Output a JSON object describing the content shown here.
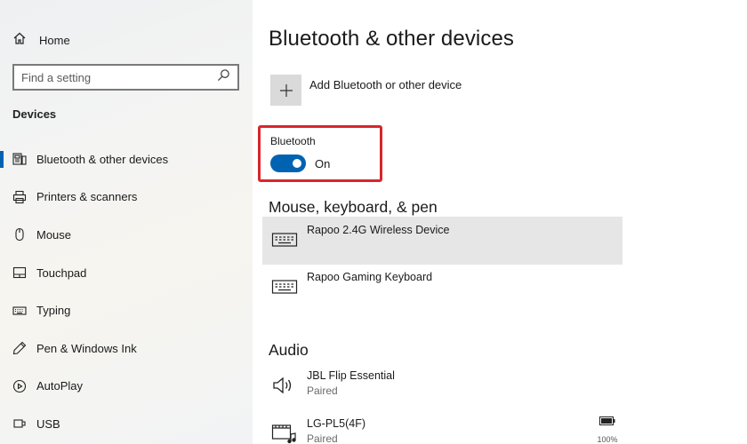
{
  "sidebar": {
    "home_label": "Home",
    "search_placeholder": "Find a setting",
    "section_title": "Devices",
    "items": [
      {
        "label": "Bluetooth & other devices",
        "icon": "bluetooth-devices-icon",
        "active": true
      },
      {
        "label": "Printers & scanners",
        "icon": "printer-icon"
      },
      {
        "label": "Mouse",
        "icon": "mouse-icon"
      },
      {
        "label": "Touchpad",
        "icon": "touchpad-icon"
      },
      {
        "label": "Typing",
        "icon": "keyboard-icon"
      },
      {
        "label": "Pen & Windows Ink",
        "icon": "pen-icon"
      },
      {
        "label": "AutoPlay",
        "icon": "autoplay-icon"
      },
      {
        "label": "USB",
        "icon": "usb-icon"
      }
    ]
  },
  "main": {
    "title": "Bluetooth & other devices",
    "add_device_label": "Add Bluetooth or other device",
    "bluetooth": {
      "label": "Bluetooth",
      "state_label": "On",
      "enabled": true
    },
    "mouse_keyboard_pen": {
      "title": "Mouse, keyboard, & pen",
      "devices": [
        {
          "name": "Rapoo 2.4G Wireless Device",
          "icon": "keyboard-icon"
        },
        {
          "name": "Rapoo Gaming Keyboard",
          "icon": "keyboard-icon"
        }
      ]
    },
    "audio": {
      "title": "Audio",
      "devices": [
        {
          "name": "JBL Flip Essential",
          "status": "Paired",
          "icon": "speaker-icon"
        },
        {
          "name": "LG-PL5(4F)",
          "status": "Paired",
          "icon": "media-device-icon",
          "battery": "100%"
        }
      ]
    }
  },
  "colors": {
    "accent": "#0063b1",
    "highlight_border": "#d8262c",
    "hover_row": "#e6e6e6"
  }
}
